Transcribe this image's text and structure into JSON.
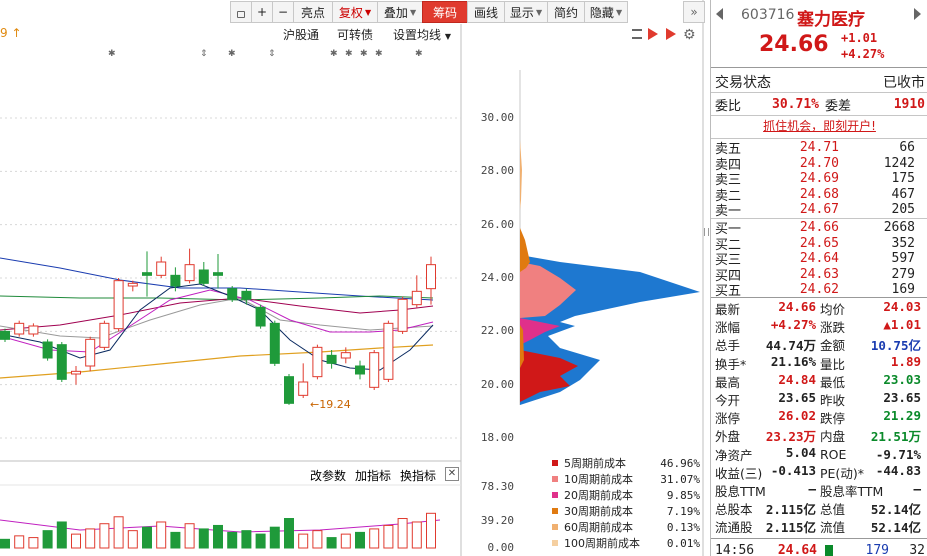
{
  "toolbar": {
    "buttons": [
      {
        "label": "",
        "icon": "lock-icon"
      },
      {
        "label": "+",
        "icon": "zoom-in-icon"
      },
      {
        "label": "−",
        "icon": "zoom-out-icon"
      },
      {
        "label": "亮点"
      },
      {
        "label": "复权",
        "dropdown": true,
        "style": "red"
      },
      {
        "label": "叠加",
        "dropdown": true
      },
      {
        "label": "筹码",
        "style": "active"
      },
      {
        "label": "画线"
      },
      {
        "label": "显示",
        "dropdown": true
      },
      {
        "label": "简约"
      },
      {
        "label": "隐藏",
        "dropdown": true
      }
    ],
    "nav_icon": "double-chevron-right-icon"
  },
  "chart_header": {
    "left_fragment": "9 ↑",
    "links": [
      "沪股通",
      "可转债",
      "设置均线"
    ]
  },
  "indicator_header": {
    "links": [
      "改参数",
      "加指标",
      "换指标"
    ],
    "close_icon": "close-icon"
  },
  "stock": {
    "code": "603716",
    "name": "塞力医疗",
    "price": "24.66",
    "change": "+1.01",
    "change_pct": "+4.27%",
    "trade_status_label": "交易状态",
    "trade_status": "已收市",
    "wb_label": "委比",
    "wb_value": "30.71%",
    "wc_label": "委差",
    "wc_value": "1910",
    "promo": "抓住机会，即刻开户!"
  },
  "order_book": {
    "asks": [
      {
        "label": "卖五",
        "price": "24.71",
        "vol": "66"
      },
      {
        "label": "卖四",
        "price": "24.70",
        "vol": "1242"
      },
      {
        "label": "卖三",
        "price": "24.69",
        "vol": "175"
      },
      {
        "label": "卖二",
        "price": "24.68",
        "vol": "467"
      },
      {
        "label": "卖一",
        "price": "24.67",
        "vol": "205"
      }
    ],
    "bids": [
      {
        "label": "买一",
        "price": "24.66",
        "vol": "2668"
      },
      {
        "label": "买二",
        "price": "24.65",
        "vol": "352"
      },
      {
        "label": "买三",
        "price": "24.64",
        "vol": "597"
      },
      {
        "label": "买四",
        "price": "24.63",
        "vol": "279"
      },
      {
        "label": "买五",
        "price": "24.62",
        "vol": "169"
      }
    ]
  },
  "quotes": [
    [
      {
        "l": "最新",
        "v": "24.66",
        "c": "red"
      },
      {
        "l": "均价",
        "v": "24.03",
        "c": "red"
      }
    ],
    [
      {
        "l": "涨幅",
        "v": "+4.27%",
        "c": "red"
      },
      {
        "l": "涨跌",
        "v": "▲1.01",
        "c": "red"
      }
    ],
    [
      {
        "l": "总手",
        "v": "44.74万",
        "c": "black"
      },
      {
        "l": "金额",
        "v": "10.75亿",
        "c": "blue"
      }
    ],
    [
      {
        "l": "换手*",
        "v": "21.16%",
        "c": "black"
      },
      {
        "l": "量比",
        "v": "1.89",
        "c": "red"
      }
    ],
    [
      {
        "l": "最高",
        "v": "24.84",
        "c": "red"
      },
      {
        "l": "最低",
        "v": "23.03",
        "c": "green"
      }
    ],
    [
      {
        "l": "今开",
        "v": "23.65",
        "c": "black"
      },
      {
        "l": "昨收",
        "v": "23.65",
        "c": "black"
      }
    ],
    [
      {
        "l": "涨停",
        "v": "26.02",
        "c": "red"
      },
      {
        "l": "跌停",
        "v": "21.29",
        "c": "green"
      }
    ],
    [
      {
        "l": "外盘",
        "v": "23.23万",
        "c": "red"
      },
      {
        "l": "内盘",
        "v": "21.51万",
        "c": "green"
      }
    ],
    [
      {
        "l": "净资产",
        "v": "5.04",
        "c": "black"
      },
      {
        "l": "ROE",
        "v": "-9.71%",
        "c": "black"
      }
    ],
    [
      {
        "l": "收益(三)",
        "v": "-0.413",
        "c": "black"
      },
      {
        "l": "PE(动)*",
        "v": "-44.83",
        "c": "black"
      }
    ],
    [
      {
        "l": "股息TTM",
        "v": "—",
        "c": "black"
      },
      {
        "l": "股息率TTM",
        "v": "—",
        "c": "black"
      }
    ],
    [
      {
        "l": "总股本",
        "v": "2.115亿",
        "c": "black"
      },
      {
        "l": "总值",
        "v": "52.14亿",
        "c": "black"
      }
    ],
    [
      {
        "l": "流通股",
        "v": "2.115亿",
        "c": "black"
      },
      {
        "l": "流值",
        "v": "52.14亿",
        "c": "black"
      }
    ]
  ],
  "tick": {
    "time": "14:56",
    "price": "24.64",
    "vol": "179",
    "num": "32"
  },
  "chart_data": {
    "type": "candlestick",
    "price_axis_ticks": [
      "30.00",
      "28.00",
      "26.00",
      "24.00",
      "22.00",
      "20.00",
      "18.00"
    ],
    "volume_axis_ticks": [
      "78.30",
      "39.20",
      "0.00"
    ],
    "annotations": [
      "←19.24"
    ],
    "candles": [
      {
        "o": 22.0,
        "c": 21.7,
        "h": 22.1,
        "l": 21.6
      },
      {
        "o": 21.9,
        "c": 22.3,
        "h": 22.4,
        "l": 21.8
      },
      {
        "o": 21.9,
        "c": 22.2,
        "h": 22.3,
        "l": 21.8
      },
      {
        "o": 21.6,
        "c": 21.0,
        "h": 21.7,
        "l": 20.9
      },
      {
        "o": 21.5,
        "c": 20.2,
        "h": 21.6,
        "l": 20.1
      },
      {
        "o": 20.4,
        "c": 20.5,
        "h": 20.7,
        "l": 20.0
      },
      {
        "o": 20.7,
        "c": 21.7,
        "h": 21.8,
        "l": 20.5
      },
      {
        "o": 21.4,
        "c": 22.3,
        "h": 22.4,
        "l": 21.3
      },
      {
        "o": 22.1,
        "c": 23.9,
        "h": 24.0,
        "l": 22.0
      },
      {
        "o": 23.7,
        "c": 23.8,
        "h": 23.9,
        "l": 23.5
      },
      {
        "o": 24.2,
        "c": 24.1,
        "h": 25.0,
        "l": 23.3
      },
      {
        "o": 24.1,
        "c": 24.6,
        "h": 24.8,
        "l": 24.0
      },
      {
        "o": 24.1,
        "c": 23.7,
        "h": 24.4,
        "l": 23.5
      },
      {
        "o": 23.9,
        "c": 24.5,
        "h": 25.1,
        "l": 23.8
      },
      {
        "o": 24.3,
        "c": 23.8,
        "h": 24.6,
        "l": 23.7
      },
      {
        "o": 24.2,
        "c": 24.1,
        "h": 24.9,
        "l": 23.6
      },
      {
        "o": 23.6,
        "c": 23.2,
        "h": 23.7,
        "l": 23.1
      },
      {
        "o": 23.5,
        "c": 23.2,
        "h": 23.6,
        "l": 23.0
      },
      {
        "o": 22.9,
        "c": 22.2,
        "h": 23.0,
        "l": 22.1
      },
      {
        "o": 22.3,
        "c": 20.8,
        "h": 22.4,
        "l": 20.7
      },
      {
        "o": 20.3,
        "c": 19.3,
        "h": 20.4,
        "l": 19.24
      },
      {
        "o": 19.6,
        "c": 20.1,
        "h": 20.8,
        "l": 19.5
      },
      {
        "o": 20.3,
        "c": 21.4,
        "h": 21.5,
        "l": 20.2
      },
      {
        "o": 21.1,
        "c": 20.8,
        "h": 21.3,
        "l": 20.6
      },
      {
        "o": 21.0,
        "c": 21.2,
        "h": 21.4,
        "l": 20.8
      },
      {
        "o": 20.7,
        "c": 20.4,
        "h": 20.9,
        "l": 20.2
      },
      {
        "o": 19.9,
        "c": 21.2,
        "h": 21.3,
        "l": 19.8
      },
      {
        "o": 20.2,
        "c": 22.3,
        "h": 22.4,
        "l": 20.1
      },
      {
        "o": 22.0,
        "c": 23.2,
        "h": 23.3,
        "l": 21.9
      },
      {
        "o": 23.0,
        "c": 23.5,
        "h": 24.1,
        "l": 22.9
      },
      {
        "o": 23.6,
        "c": 24.5,
        "h": 24.8,
        "l": 23.0
      }
    ],
    "chip_legend": [
      {
        "name": "5周期前成本",
        "pct": "46.96%",
        "color": "#d01818"
      },
      {
        "name": "10周期前成本",
        "pct": "31.07%",
        "color": "#f08080"
      },
      {
        "name": "20周期前成本",
        "pct": "9.85%",
        "color": "#e0308a"
      },
      {
        "name": "30周期前成本",
        "pct": "7.19%",
        "color": "#e07a10"
      },
      {
        "name": "60周期前成本",
        "pct": "0.13%",
        "color": "#f0b070"
      },
      {
        "name": "100周期前成本",
        "pct": "0.01%",
        "color": "#f5cfa0"
      }
    ]
  }
}
